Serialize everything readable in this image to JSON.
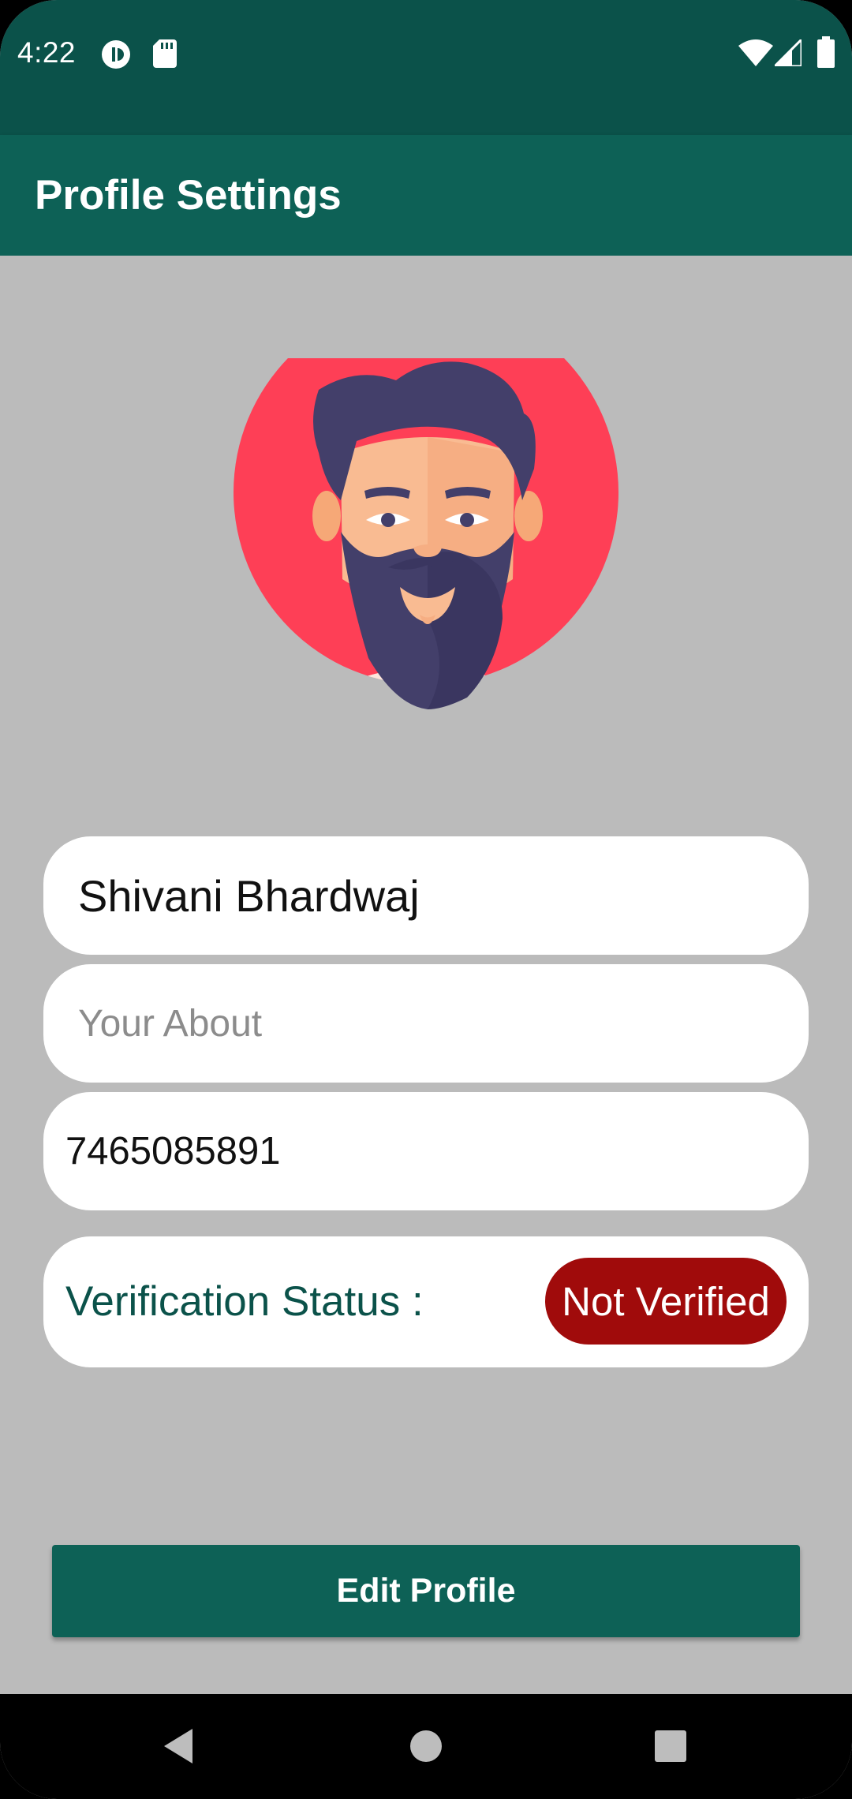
{
  "status_bar": {
    "time": "4:22",
    "left_icons": [
      "sync-icon",
      "sd-card-icon"
    ],
    "right_icons": [
      "wifi-icon",
      "cellular-signal-icon",
      "battery-icon"
    ]
  },
  "app_bar": {
    "title": "Profile Settings"
  },
  "profile": {
    "avatar_icon": "bearded-man-avatar-icon",
    "name_value": "Shivani Bhardwaj",
    "about_placeholder": "Your About",
    "about_value": "",
    "phone_value": "7465085891",
    "verification_label": "Verification Status :",
    "verification_status": "Not Verified"
  },
  "actions": {
    "edit_label": "Edit Profile"
  },
  "nav_bar": {
    "icons": [
      "back-icon",
      "home-icon",
      "recents-icon"
    ]
  },
  "colors": {
    "status_bar": "#0b524a",
    "app_bar": "#0d6156",
    "background": "#bbbbbb",
    "status_badge": "#a00b0b",
    "avatar_circle": "#fe3f56"
  }
}
